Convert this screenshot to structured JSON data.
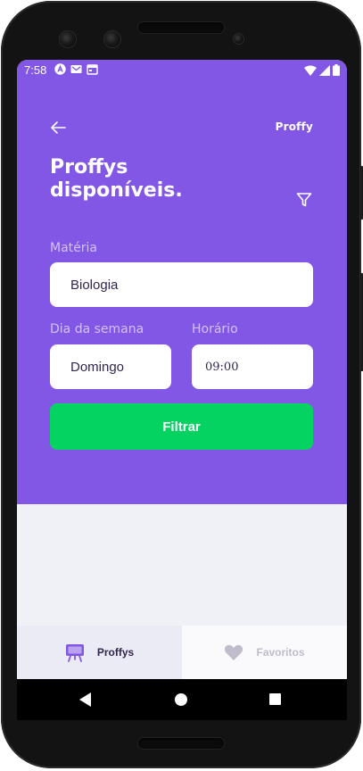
{
  "status_bar": {
    "time": "7:58"
  },
  "header": {
    "brand": "Proffy",
    "title": "Proffys disponíveis."
  },
  "filters": {
    "subject_label": "Matéria",
    "subject_value": "Biologia",
    "weekday_label": "Dia da semana",
    "weekday_value": "Domingo",
    "time_label": "Horário",
    "time_value": "09:00",
    "submit_label": "Filtrar"
  },
  "tabs": [
    {
      "label": "Proffys",
      "icon": "easel-icon",
      "active": true
    },
    {
      "label": "Favoritos",
      "icon": "heart-icon",
      "active": false
    }
  ],
  "colors": {
    "primary": "#8257e5",
    "secondary": "#04d361",
    "background": "#f0f0f7",
    "label": "#d4c2ff",
    "text_dark": "#32264d",
    "tab_inactive_text": "#c1bccc"
  }
}
